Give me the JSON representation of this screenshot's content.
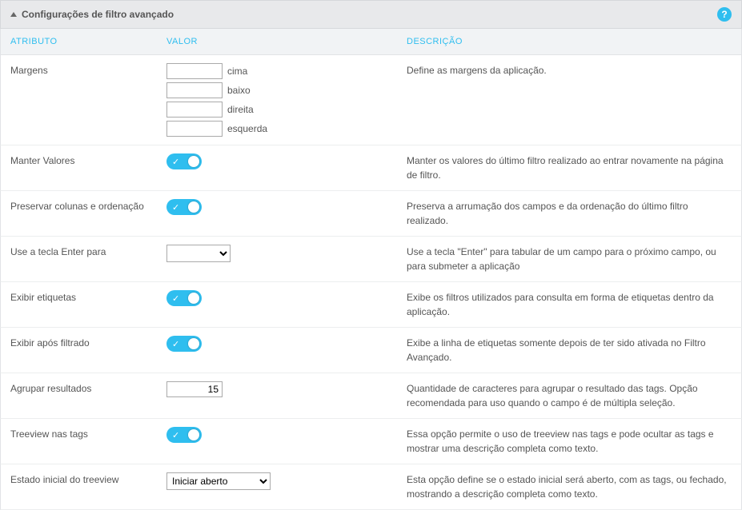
{
  "panel": {
    "title": "Configurações de filtro avançado"
  },
  "headers": {
    "attr": "ATRIBUTO",
    "val": "VALOR",
    "desc": "DESCRIÇÃO"
  },
  "rows": {
    "margins": {
      "label": "Margens",
      "desc": "Define as margens da aplicação.",
      "top_val": "",
      "top_label": "cima",
      "bottom_val": "",
      "bottom_label": "baixo",
      "right_val": "",
      "right_label": "direita",
      "left_val": "",
      "left_label": "esquerda"
    },
    "keep_values": {
      "label": "Manter Valores",
      "desc": "Manter os valores do último filtro realizado ao entrar novamente na página de filtro."
    },
    "preserve_cols": {
      "label": "Preservar colunas e ordenação",
      "desc": "Preserva a arrumação dos campos e da ordenação do último filtro realizado."
    },
    "enter_key": {
      "label": "Use a tecla Enter para",
      "desc": "Use a tecla \"Enter\" para tabular de um campo para o próximo campo, ou para submeter a aplicação",
      "selected": ""
    },
    "show_tags": {
      "label": "Exibir etiquetas",
      "desc": "Exibe os filtros utilizados para consulta em forma de etiquetas dentro da aplicação."
    },
    "show_after": {
      "label": "Exibir após filtrado",
      "desc": "Exibe a linha de etiquetas somente depois de ter sido ativada no Filtro Avançado."
    },
    "group_results": {
      "label": "Agrupar resultados",
      "value": "15",
      "desc": "Quantidade de caracteres para agrupar o resultado das tags. Opção recomendada para uso quando o campo é de múltipla seleção."
    },
    "treeview_tags": {
      "label": "Treeview nas tags",
      "desc": "Essa opção permite o uso de treeview nas tags e pode ocultar as tags e mostrar uma descrição completa como texto."
    },
    "treeview_state": {
      "label": "Estado inicial do treeview",
      "selected": "Iniciar aberto",
      "desc": "Esta opção define se o estado inicial será aberto, com as tags, ou fechado, mostrando a descrição completa como texto."
    }
  }
}
